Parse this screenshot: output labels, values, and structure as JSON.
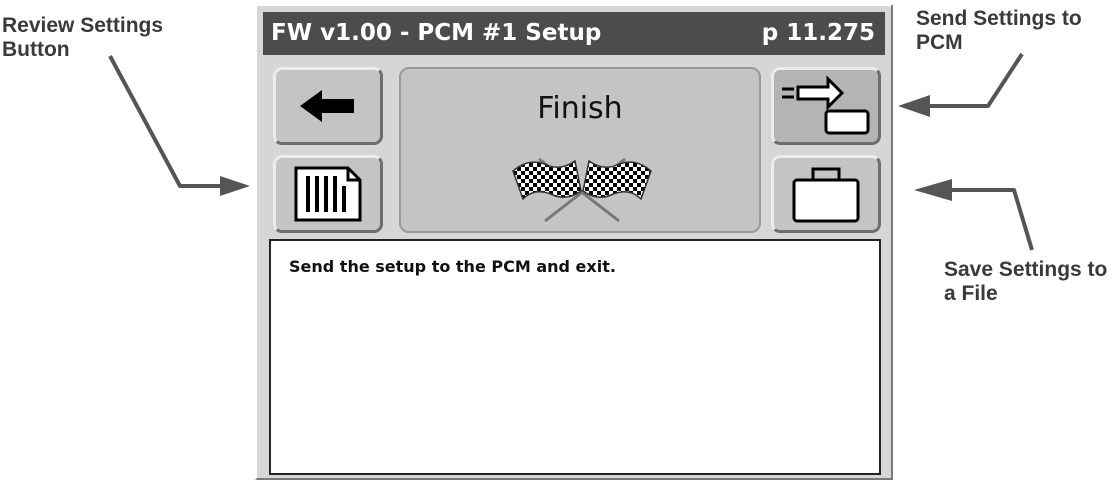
{
  "callouts": {
    "review": "Review Settings Button",
    "send": "Send Settings to PCM",
    "save": "Save Settings to a File"
  },
  "title_bar": {
    "title": "FW v1.00 - PCM #1 Setup",
    "page": "p 11.275"
  },
  "panel": {
    "title": "Finish",
    "icon": "checkered-flags-icon"
  },
  "buttons": {
    "back": "back-arrow-icon",
    "review": "document-icon",
    "send": "send-to-device-icon",
    "save": "briefcase-icon"
  },
  "message": "Send the setup to the PCM and exit.",
  "colors": {
    "title_bar": "#4c4c4c",
    "button": "#c4c4c4",
    "callout_arrow": "#555555",
    "frame": "#d6d6d6"
  }
}
